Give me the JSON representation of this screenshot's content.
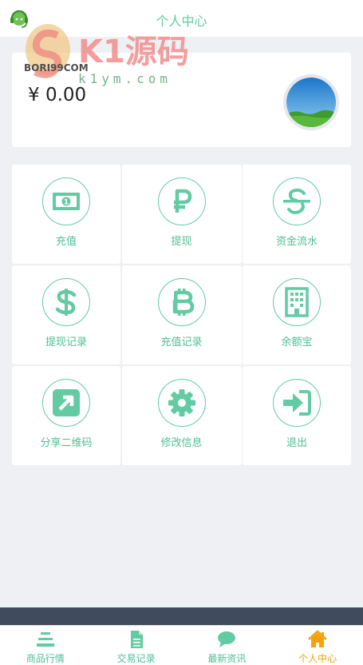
{
  "header": {
    "title": "个人中心"
  },
  "watermark": {
    "brand": "K1源码",
    "sub": "BORI99COM",
    "url": "k1ym.com"
  },
  "account": {
    "balance": "¥ 0.00"
  },
  "menu": [
    {
      "label": "充值",
      "icon": "banknote-icon"
    },
    {
      "label": "提现",
      "icon": "ruble-icon"
    },
    {
      "label": "资金流水",
      "icon": "strikethrough-s-icon"
    },
    {
      "label": "提现记录",
      "icon": "dollar-icon"
    },
    {
      "label": "充值记录",
      "icon": "bitcoin-icon"
    },
    {
      "label": "余额宝",
      "icon": "building-icon"
    },
    {
      "label": "分享二维码",
      "icon": "share-arrow-icon"
    },
    {
      "label": "修改信息",
      "icon": "gear-icon"
    },
    {
      "label": "退出",
      "icon": "sign-in-icon"
    }
  ],
  "tabs": [
    {
      "label": "商品行情",
      "icon": "stack-icon"
    },
    {
      "label": "交易记录",
      "icon": "document-icon"
    },
    {
      "label": "最新资讯",
      "icon": "chat-icon"
    },
    {
      "label": "个人中心",
      "icon": "home-icon",
      "active": true
    }
  ],
  "colors": {
    "accent": "#62cba3",
    "active_tab": "#f4a20c",
    "footer_band": "#404c5e",
    "background": "#eff0f4"
  }
}
